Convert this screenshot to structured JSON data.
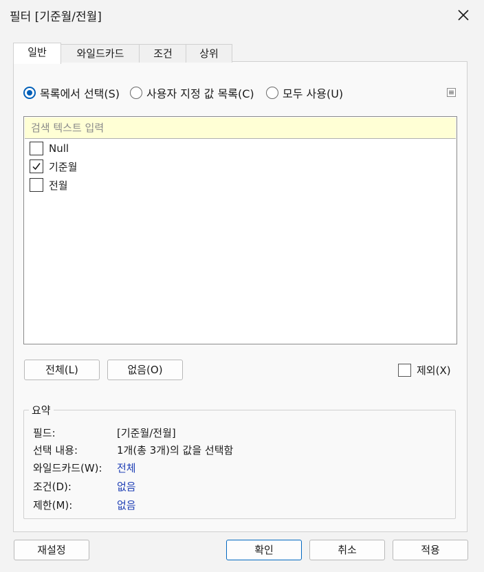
{
  "window": {
    "title": "필터 [기준월/전월]"
  },
  "tabs": [
    {
      "label": "일반",
      "active": true
    },
    {
      "label": "와일드카드",
      "active": false
    },
    {
      "label": "조건",
      "active": false
    },
    {
      "label": "상위",
      "active": false
    }
  ],
  "selection_mode": {
    "options": [
      {
        "label": "목록에서 선택(S)",
        "selected": true
      },
      {
        "label": "사용자 지정 값 목록(C)",
        "selected": false
      },
      {
        "label": "모두 사용(U)",
        "selected": false
      }
    ]
  },
  "list": {
    "search_placeholder": "검색 텍스트 입력",
    "items": [
      {
        "label": "Null",
        "checked": false
      },
      {
        "label": "기준월",
        "checked": true
      },
      {
        "label": "전월",
        "checked": false
      }
    ]
  },
  "list_buttons": {
    "all": "전체(L)",
    "none": "없음(O)"
  },
  "exclude": {
    "label": "제외(X)",
    "checked": false
  },
  "summary": {
    "title": "요약",
    "field_label": "필드:",
    "field_value": "[기준월/전월]",
    "selection_label": "선택 내용:",
    "selection_value": "1개(총 3개)의 값을 선택함",
    "wildcard_label": "와일드카드(W):",
    "wildcard_value": "전체",
    "condition_label": "조건(D):",
    "condition_value": "없음",
    "limit_label": "제한(M):",
    "limit_value": "없음"
  },
  "footer": {
    "reset": "재설정",
    "ok": "확인",
    "cancel": "취소",
    "apply": "적용"
  },
  "colors": {
    "accent": "#005fb8",
    "link": "#1f3fb5",
    "search_bg": "#ffffd5"
  }
}
